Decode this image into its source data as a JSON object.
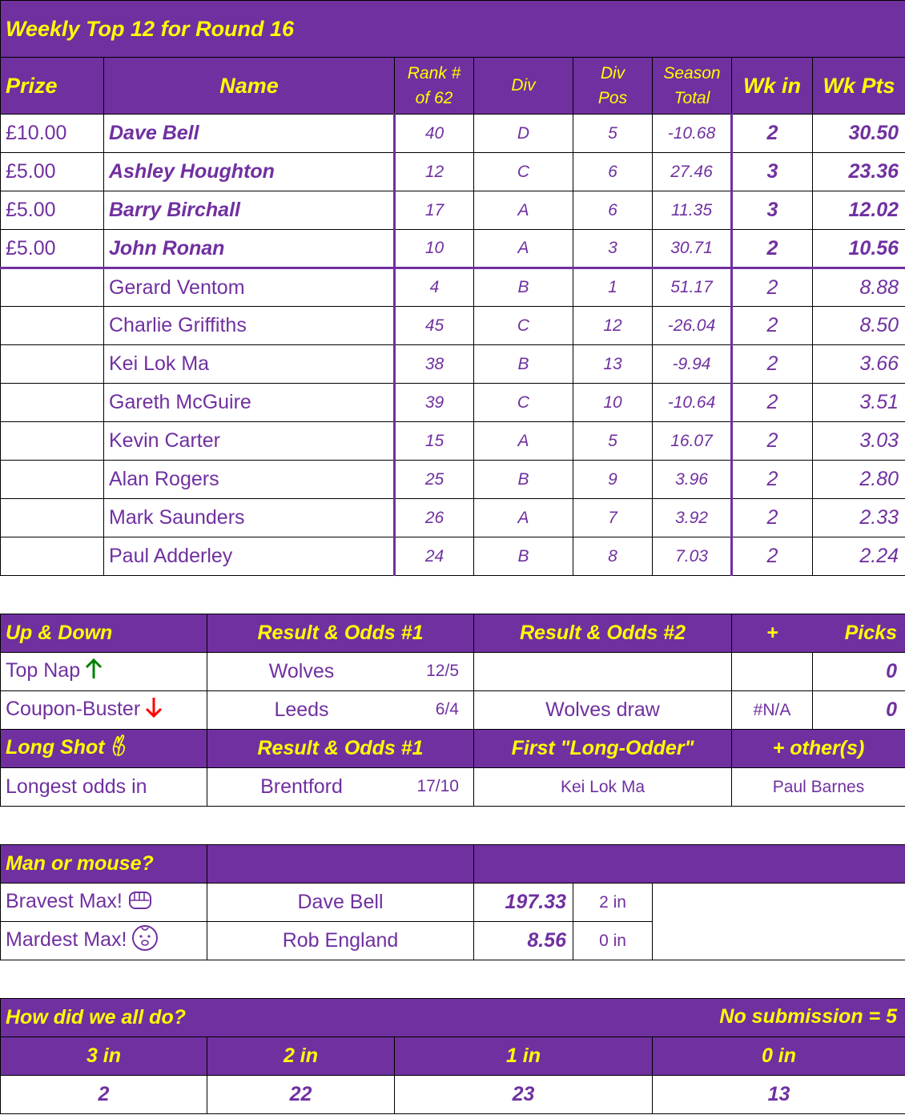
{
  "top12": {
    "title": "Weekly Top 12 for Round 16",
    "headers": {
      "prize": "Prize",
      "name": "Name",
      "rank_line1": "Rank #",
      "rank_line2": "of 62",
      "div": "Div",
      "divpos_line1": "Div",
      "divpos_line2": "Pos",
      "season_line1": "Season",
      "season_line2": "Total",
      "wkin": "Wk in",
      "wkpts": "Wk Pts"
    },
    "rows": [
      {
        "prize": "£10.00",
        "name": "Dave Bell",
        "rank": "40",
        "div": "D",
        "divpos": "5",
        "season": "-10.68",
        "wkin": "2",
        "wkpts": "30.50"
      },
      {
        "prize": "£5.00",
        "name": "Ashley Houghton",
        "rank": "12",
        "div": "C",
        "divpos": "6",
        "season": "27.46",
        "wkin": "3",
        "wkpts": "23.36"
      },
      {
        "prize": "£5.00",
        "name": "Barry Birchall",
        "rank": "17",
        "div": "A",
        "divpos": "6",
        "season": "11.35",
        "wkin": "3",
        "wkpts": "12.02"
      },
      {
        "prize": "£5.00",
        "name": "John Ronan",
        "rank": "10",
        "div": "A",
        "divpos": "3",
        "season": "30.71",
        "wkin": "2",
        "wkpts": "10.56"
      },
      {
        "prize": "",
        "name": "Gerard Ventom",
        "rank": "4",
        "div": "B",
        "divpos": "1",
        "season": "51.17",
        "wkin": "2",
        "wkpts": "8.88"
      },
      {
        "prize": "",
        "name": "Charlie Griffiths",
        "rank": "45",
        "div": "C",
        "divpos": "12",
        "season": "-26.04",
        "wkin": "2",
        "wkpts": "8.50"
      },
      {
        "prize": "",
        "name": "Kei Lok Ma",
        "rank": "38",
        "div": "B",
        "divpos": "13",
        "season": "-9.94",
        "wkin": "2",
        "wkpts": "3.66"
      },
      {
        "prize": "",
        "name": "Gareth McGuire",
        "rank": "39",
        "div": "C",
        "divpos": "10",
        "season": "-10.64",
        "wkin": "2",
        "wkpts": "3.51"
      },
      {
        "prize": "",
        "name": "Kevin Carter",
        "rank": "15",
        "div": "A",
        "divpos": "5",
        "season": "16.07",
        "wkin": "2",
        "wkpts": "3.03"
      },
      {
        "prize": "",
        "name": "Alan Rogers",
        "rank": "25",
        "div": "B",
        "divpos": "9",
        "season": "3.96",
        "wkin": "2",
        "wkpts": "2.80"
      },
      {
        "prize": "",
        "name": "Mark Saunders",
        "rank": "26",
        "div": "A",
        "divpos": "7",
        "season": "3.92",
        "wkin": "2",
        "wkpts": "2.33"
      },
      {
        "prize": "",
        "name": "Paul Adderley",
        "rank": "24",
        "div": "B",
        "divpos": "8",
        "season": "7.03",
        "wkin": "2",
        "wkpts": "2.24"
      }
    ]
  },
  "updown": {
    "headers": {
      "label": "Up & Down",
      "result1": "Result & Odds #1",
      "result2": "Result & Odds #2",
      "plus": "+",
      "picks": "Picks"
    },
    "rows": [
      {
        "label": "Top Nap",
        "arrow": "up-arrow-icon",
        "arrow_color": "#008000",
        "team1": "Wolves",
        "odds1": "12/5",
        "result2": "",
        "plus": "",
        "picks": "0"
      },
      {
        "label": "Coupon-Buster",
        "arrow": "down-arrow-icon",
        "arrow_color": "#ff0000",
        "team1": "Leeds",
        "odds1": "6/4",
        "result2": "Wolves draw",
        "plus": "#N/A",
        "picks": "0"
      }
    ],
    "longshot_headers": {
      "label": "Long Shot",
      "result1": "Result & Odds #1",
      "first": "First \"Long-Odder\"",
      "others": "+ other(s)"
    },
    "longshot_row": {
      "label": "Longest odds in",
      "team1": "Brentford",
      "odds1": "17/10",
      "first": "Kei Lok Ma",
      "others": "Paul Barnes"
    }
  },
  "mom": {
    "title": "Man or mouse?",
    "rows": [
      {
        "label": "Bravest Max!",
        "icon": "fist-icon",
        "name": "Dave Bell",
        "score": "197.33",
        "in": "2 in"
      },
      {
        "label": "Mardest Max!",
        "icon": "baby-face-icon",
        "name": "Rob England",
        "score": "8.56",
        "in": "0 in"
      }
    ]
  },
  "summary": {
    "title": "How did we all do?",
    "note": "No submission = 5",
    "headers": [
      "3 in",
      "2 in",
      "1 in",
      "0 in"
    ],
    "values": [
      "2",
      "22",
      "23",
      "13"
    ]
  }
}
